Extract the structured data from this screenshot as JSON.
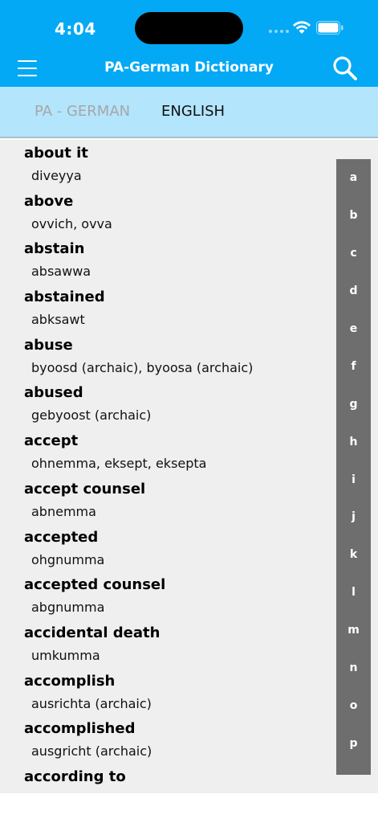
{
  "status_bar": {
    "time": "4:04"
  },
  "app_bar": {
    "title": "PA-German Dictionary"
  },
  "language_tabs": [
    {
      "label": "PA - GERMAN",
      "active": false
    },
    {
      "label": "ENGLISH",
      "active": true
    }
  ],
  "entries": [
    {
      "term": "about it",
      "translation": "diveyya"
    },
    {
      "term": "above",
      "translation": "ovvich, ovva"
    },
    {
      "term": "abstain",
      "translation": "absawwa"
    },
    {
      "term": "abstained",
      "translation": "abksawt"
    },
    {
      "term": "abuse",
      "translation": "byoosd (archaic), byoosa (archaic)"
    },
    {
      "term": "abused",
      "translation": "gebyoost (archaic)"
    },
    {
      "term": "accept",
      "translation": "ohnemma, eksept, eksepta"
    },
    {
      "term": "accept counsel",
      "translation": "abnemma"
    },
    {
      "term": "accepted",
      "translation": "ohgnumma"
    },
    {
      "term": "accepted counsel",
      "translation": "abgnumma"
    },
    {
      "term": "accidental death",
      "translation": "umkumma"
    },
    {
      "term": "accomplish",
      "translation": "ausrichta (archaic)"
    },
    {
      "term": "accomplished",
      "translation": "ausgricht (archaic)"
    },
    {
      "term": "according to",
      "translation": ""
    }
  ],
  "index_letters": [
    "a",
    "b",
    "c",
    "d",
    "e",
    "f",
    "g",
    "h",
    "i",
    "j",
    "k",
    "l",
    "m",
    "n",
    "o",
    "p"
  ],
  "colors": {
    "primary": "#03a9f4",
    "tab_bar": "#b3e5fc",
    "index_bar": "#6e6e6e",
    "list_bg": "#efefef"
  }
}
